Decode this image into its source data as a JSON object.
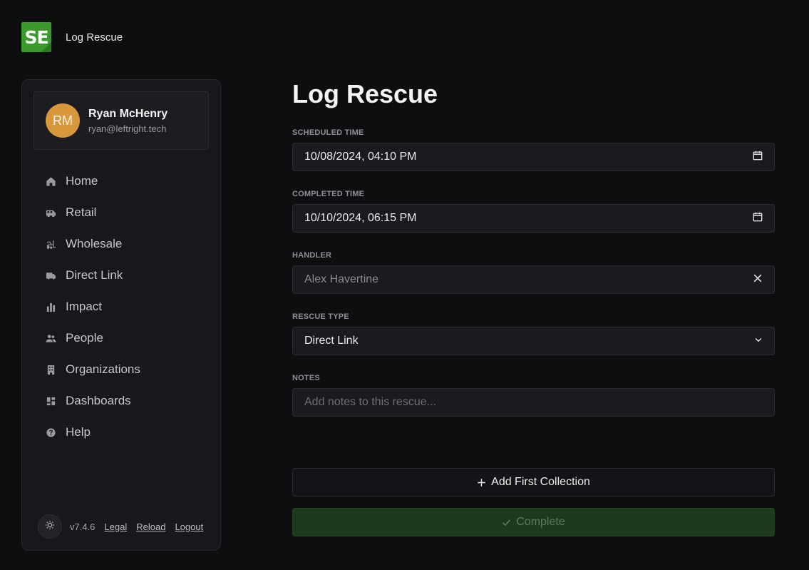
{
  "header": {
    "logo_text": "SE",
    "title": "Log Rescue"
  },
  "user": {
    "initials": "RM",
    "name": "Ryan McHenry",
    "email": "ryan@leftright.tech"
  },
  "nav": [
    {
      "label": "Home",
      "icon": "home-icon"
    },
    {
      "label": "Retail",
      "icon": "van-icon"
    },
    {
      "label": "Wholesale",
      "icon": "forklift-icon"
    },
    {
      "label": "Direct Link",
      "icon": "truck-icon"
    },
    {
      "label": "Impact",
      "icon": "bar-chart-icon"
    },
    {
      "label": "People",
      "icon": "people-icon"
    },
    {
      "label": "Organizations",
      "icon": "building-icon"
    },
    {
      "label": "Dashboards",
      "icon": "dashboard-icon"
    },
    {
      "label": "Help",
      "icon": "help-icon"
    }
  ],
  "footer": {
    "version": "v7.4.6",
    "legal": "Legal",
    "reload": "Reload",
    "logout": "Logout",
    "theme_icon": "sun-icon"
  },
  "form": {
    "title": "Log Rescue",
    "scheduled_label": "SCHEDULED TIME",
    "scheduled_value": "10/08/2024, 04:10 PM",
    "completed_label": "COMPLETED TIME",
    "completed_value": "10/10/2024, 06:15 PM",
    "handler_label": "HANDLER",
    "handler_value": "Alex Havertine",
    "type_label": "RESCUE TYPE",
    "type_value": "Direct Link",
    "notes_label": "NOTES",
    "notes_placeholder": "Add notes to this rescue...",
    "add_collection": "Add First Collection",
    "complete": "Complete"
  },
  "colors": {
    "brand": "#3a9a2a",
    "avatar": "#d8973a",
    "complete_bg": "#1d3a1c"
  }
}
